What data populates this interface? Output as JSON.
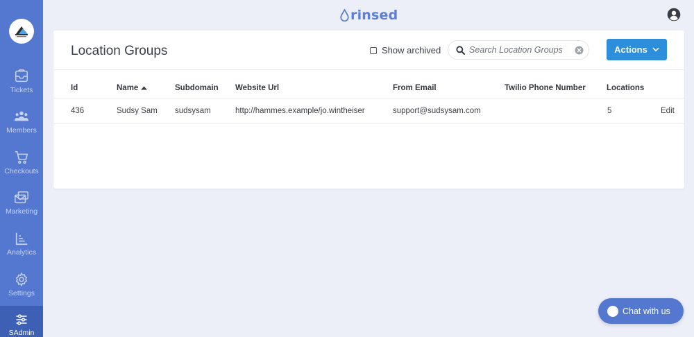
{
  "brand": {
    "name": "rinsed",
    "color": "#5b7fd6"
  },
  "sidebar": {
    "logo_icon": "company-logo",
    "items": [
      {
        "label": "Tickets",
        "icon": "ticket-icon",
        "active": false
      },
      {
        "label": "Members",
        "icon": "members-icon",
        "active": false
      },
      {
        "label": "Checkouts",
        "icon": "cart-icon",
        "active": false
      },
      {
        "label": "Marketing",
        "icon": "marketing-icon",
        "active": false
      },
      {
        "label": "Analytics",
        "icon": "analytics-icon",
        "active": false
      },
      {
        "label": "Settings",
        "icon": "gear-icon",
        "active": false
      },
      {
        "label": "SAdmin",
        "icon": "sliders-icon",
        "active": true
      }
    ]
  },
  "page": {
    "title": "Location Groups",
    "show_archived_label": "Show archived",
    "show_archived_checked": false,
    "search": {
      "placeholder": "Search Location Groups",
      "value": ""
    },
    "actions_label": "Actions"
  },
  "table": {
    "columns": [
      "Id",
      "Name",
      "Subdomain",
      "Website Url",
      "From Email",
      "Twilio Phone Number",
      "Locations"
    ],
    "sort": {
      "column": "Name",
      "direction": "asc"
    },
    "rows": [
      {
        "id": "436",
        "name": "Sudsy Sam",
        "subdomain": "sudsysam",
        "website_url": "http://hammes.example/jo.wintheiser",
        "from_email": "support@sudsysam.com",
        "twilio_phone": "",
        "locations": "5",
        "edit_label": "Edit"
      }
    ]
  },
  "chat": {
    "label": "Chat with us"
  },
  "colors": {
    "sidebar": "#5478cf",
    "primary_button": "#2d8fdc",
    "background": "#eceef8"
  }
}
